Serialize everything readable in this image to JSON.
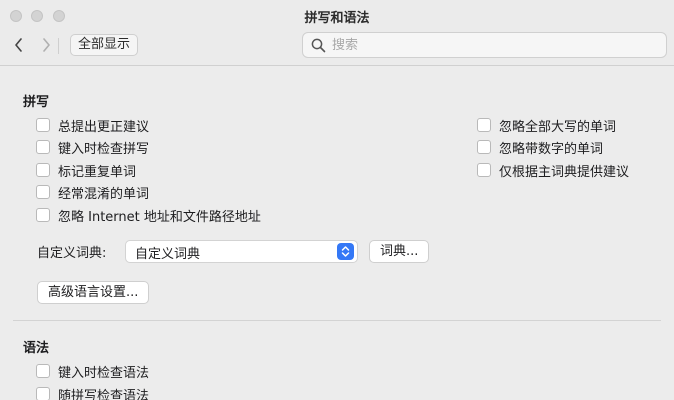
{
  "window": {
    "title": "拼写和语法"
  },
  "toolbar": {
    "show_all_label": "全部显示"
  },
  "search": {
    "placeholder": "搜索"
  },
  "spelling": {
    "section_title": "拼写",
    "left_options": [
      {
        "label": "总提出更正建议",
        "checked": false
      },
      {
        "label": "键入时检查拼写",
        "checked": false
      },
      {
        "label": "标记重复单词",
        "checked": false
      },
      {
        "label": "经常混淆的单词",
        "checked": false
      },
      {
        "label": "忽略 Internet 地址和文件路径地址",
        "checked": false
      }
    ],
    "right_options": [
      {
        "label": "忽略全部大写的单词",
        "checked": false
      },
      {
        "label": "忽略带数字的单词",
        "checked": false
      },
      {
        "label": "仅根据主词典提供建议",
        "checked": false
      }
    ],
    "custom_dict_label": "自定义词典:",
    "custom_dict_value": "自定义词典",
    "dictionary_button": "词典...",
    "advanced_button": "高级语言设置..."
  },
  "grammar": {
    "section_title": "语法",
    "options": [
      {
        "label": "键入时检查语法",
        "checked": false
      },
      {
        "label": "随拼写检查语法",
        "checked": false
      }
    ]
  },
  "icons": {
    "back": "chevron-left-icon",
    "forward": "chevron-right-icon",
    "search": "magnifier-icon",
    "select": "up-down-chevron-icon"
  }
}
